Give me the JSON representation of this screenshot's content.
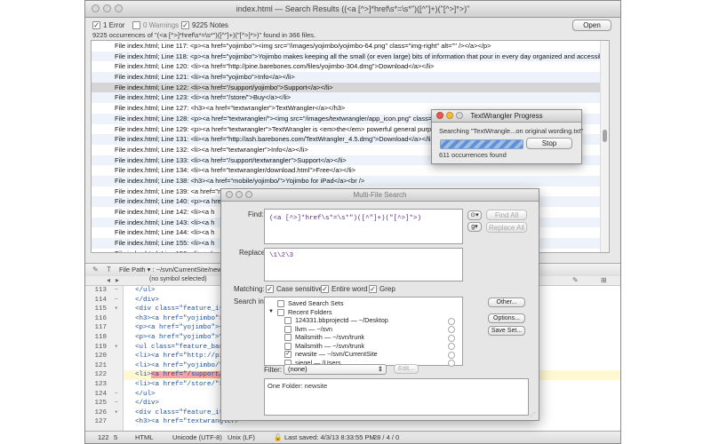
{
  "main_window": {
    "title": "index.html — Search Results ((<a [^>]*href\\s*=\\s*\")([^\"]+)(\"[^>]*>)\"",
    "filters": [
      {
        "label": "1 Error",
        "checked": true
      },
      {
        "label": "0 Warnings",
        "checked": false
      },
      {
        "label": "9225 Notes",
        "checked": true
      }
    ],
    "open_button": "Open",
    "summary": "9225 occurrences of \"(<a [^>]*href\\s*=\\s*\")([^\"]+)(\"[^>]*>)\" found in 366 files."
  },
  "results": [
    "File index.html; Line 117: <p><a href=\"yojimbo\"><img src=\"/images/yojimbo/yojimbo-64.png\" class=\"img-right\" alt=\"\" /></a></p>",
    "File index.html; Line 118: <p><a href=\"yojimbo\">Yojimbo makes keeping all the small (or even large) bits of information that pour in every day organized and accessible on your Mac. It",
    "File index.html; Line 120: <li><a href=\"http://pine.barebones.com/files/yojimbo-304.dmg\">Download</a></li>",
    "File index.html; Line 121: <li><a href=\"yojimbo\">Info</a></li>",
    "File index.html; Line 122: <li><a href=\"/support/yojimbo\">Support</a></li>",
    "File index.html; Line 123: <li><a href=\"/store/\">Buy</a></li>",
    "File index.html; Line 127: <h3><a href=\"textwrangler\">TextWrangler</a></h3>",
    "File index.html; Line 128: <p><a href=\"textwrangler/\"><img src=\"/images/textwrangler/app_icon.png\" class=\"img-right",
    "File index.html; Line 129: <p><a href=\"textwrangler\">TextWrangler is <em>the</em> powerful general purpose text editor... Oh, and it",
    "File index.html; Line 131: <li><a href=\"http://ash.barebones.com/TextWrangler_4.5.dmg\">Download</a></li>",
    "File index.html; Line 132: <li><a href=\"textwrangler\">Info</a></li>",
    "File index.html; Line 133: <li><a href=\"/support/textwrangler\">Support</a></li>",
    "File index.html; Line 134: <li><a href=\"textwrangler/download.html\">Free</a></li>",
    "File index.html; Line 138: <h3><a href=\"mobile/yojimbo/\">Yojimbo for iPad</a><br />",
    "File index.html; Line 139: <a href=\"mobile/yojimbo\"><img src=\"/images/yojimbo-mobile/app-50.png\" class=\"img-right\" alt=\"\" /></a></h3>",
    "File index.html; Line 140: <p><a href=\"mobile/yojimbo\">Yojimbo for iPad... required; sold separately). It",
    "File index.html; Line 142: <li><a h",
    "File index.html; Line 143: <li><a h",
    "File index.html; Line 144: <li><a h",
    "File index.html; Line 155:            <li><a h",
    "File index.html; Line 156:            <li><a h"
  ],
  "editor": {
    "file_path_label": "File Path ▾ : ~/svn/CurrentSite/newsite",
    "symbol": "(no symbol selected)",
    "lines": [
      {
        "num": "113",
        "fold": "−",
        "code": "  </ul>"
      },
      {
        "num": "114",
        "fold": "−",
        "code": "  </div>"
      },
      {
        "num": "115",
        "fold": "▾",
        "code": "  <div class=\"feature_item\">"
      },
      {
        "num": "116",
        "fold": "",
        "code": "  <h3><a href=\"yojimbo\">Yoji"
      },
      {
        "num": "117",
        "fold": "",
        "code": "  <p><a href=\"yojimbo\"><img"
      },
      {
        "num": "118",
        "fold": "",
        "code": "  <p><a href=\"yojimbo\">Yojim                                              organized and accessi"
      },
      {
        "num": "119",
        "fold": "▾",
        "code": "  <ul class=\"feature_bar clea"
      },
      {
        "num": "120",
        "fold": "",
        "code": "  <li><a href=\"http://pine.ba"
      },
      {
        "num": "121",
        "fold": "",
        "code": "  <li><a href=\"yojimbo/\">Info"
      },
      {
        "num": "122",
        "fold": "",
        "code": "  <li><a href=\"/support/yojim"
      },
      {
        "num": "123",
        "fold": "",
        "code": "  <li><a href=\"/store/\">Buy</"
      },
      {
        "num": "124",
        "fold": "−",
        "code": "  </ul>"
      },
      {
        "num": "125",
        "fold": "−",
        "code": "  </div>"
      },
      {
        "num": "126",
        "fold": "▾",
        "code": "  <div class=\"feature_item fl"
      },
      {
        "num": "127",
        "fold": "",
        "code": "  <h3><a href=\"textwrangler/\""
      }
    ],
    "highlight_text": "<a href=\"/support/yojim"
  },
  "status_bar": {
    "position": "122",
    "col": "5",
    "language": "HTML",
    "encoding": "Unicode (UTF-8)",
    "line_endings": "Unix (LF)",
    "saved": "Last saved: 4/3/13 8:33:55 PM",
    "counts": "28 / 4 / 0"
  },
  "progress": {
    "title": "TextWrangler Progress",
    "message": "Searching \"TextWrangle...on original wording.txt\"",
    "stop": "Stop",
    "count": "611 occurrences found"
  },
  "mfs": {
    "title": "Multi-File Search",
    "find_label": "Find:",
    "find_value": "(<a [^>]*href\\s*=\\s*\")([^\"]+)(\"[^>]*>)",
    "replace_label": "Replace:",
    "replace_value": "\\1\\2\\3",
    "find_all": "Find All",
    "replace_all": "Replace All",
    "matching_label": "Matching:",
    "options": [
      {
        "label": "Case sensitive",
        "checked": true
      },
      {
        "label": "Entire word",
        "checked": true
      },
      {
        "label": "Grep",
        "checked": true
      }
    ],
    "search_in_label": "Search in:",
    "tree": [
      {
        "label": "Saved Search Sets",
        "indent": 0,
        "checked": false,
        "disc": ""
      },
      {
        "label": "Recent Folders",
        "indent": 0,
        "checked": false,
        "disc": "▼"
      },
      {
        "label": "124331.bbprojectd — ~/Desktop",
        "indent": 1,
        "checked": false,
        "disc": ""
      },
      {
        "label": "llvm — ~/svn",
        "indent": 1,
        "checked": false,
        "disc": ""
      },
      {
        "label": "Mailsmith — ~/svn/trunk",
        "indent": 1,
        "checked": false,
        "disc": ""
      },
      {
        "label": "Mailsmith — ~/svn/trunk",
        "indent": 1,
        "checked": false,
        "disc": ""
      },
      {
        "label": "newsite — ~/svn/CurrentSite",
        "indent": 1,
        "checked": true,
        "disc": ""
      },
      {
        "label": "siegel — /Users",
        "indent": 1,
        "checked": false,
        "disc": ""
      }
    ],
    "other": "Other...",
    "options_button": "Options...",
    "save_set": "Save Set...",
    "filter_label": "Filter:",
    "filter_value": "(none)",
    "edit": "Edit...",
    "summary": "One Folder: newsite"
  }
}
